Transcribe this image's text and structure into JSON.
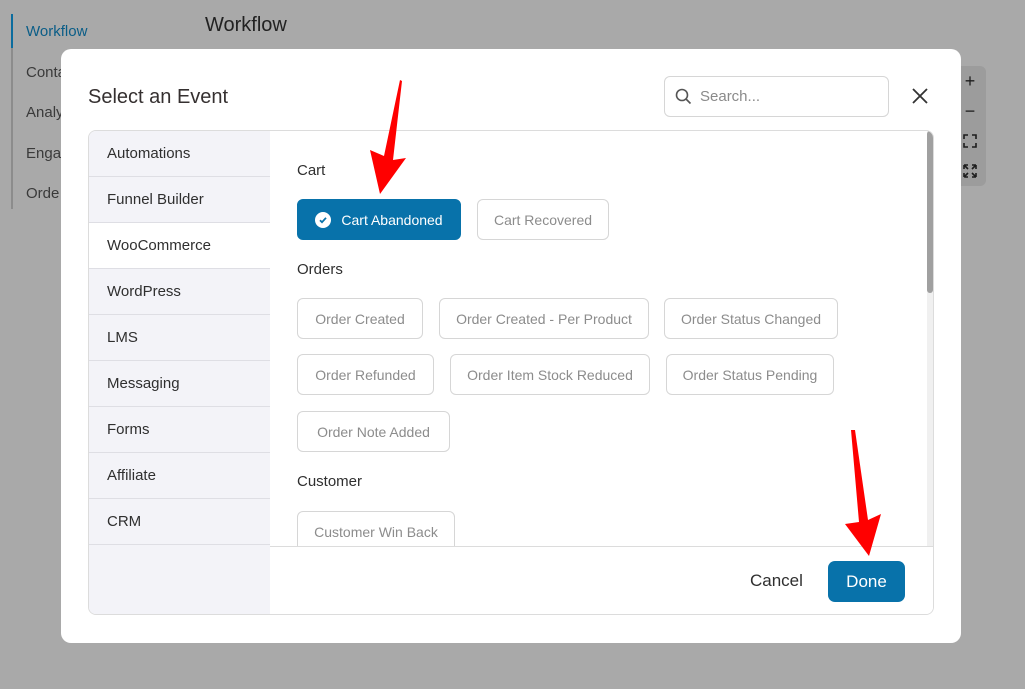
{
  "background": {
    "nav_items": [
      "Workflow",
      "Conta",
      "Analy",
      "Engag",
      "Orde"
    ],
    "page_title": "Workflow",
    "zoom": {
      "plus": "+",
      "minus": "−"
    }
  },
  "modal": {
    "title": "Select an Event",
    "search_placeholder": "Search...",
    "categories": [
      "Automations",
      "Funnel Builder",
      "WooCommerce",
      "WordPress",
      "LMS",
      "Messaging",
      "Forms",
      "Affiliate",
      "CRM"
    ],
    "active_category": "WooCommerce",
    "groups": {
      "cart": {
        "label": "Cart",
        "events": [
          "Cart Abandoned",
          "Cart Recovered"
        ]
      },
      "orders": {
        "label": "Orders",
        "events": [
          "Order Created",
          "Order Created - Per Product",
          "Order Status Changed",
          "Order Refunded",
          "Order Item Stock Reduced",
          "Order Status Pending",
          "Order Note Added"
        ]
      },
      "customer": {
        "label": "Customer",
        "events": [
          "Customer Win Back"
        ]
      }
    },
    "selected_event": "Cart Abandoned",
    "cancel_label": "Cancel",
    "done_label": "Done"
  },
  "colors": {
    "accent": "#0872aa",
    "annotation_arrow": "#ff0000"
  }
}
